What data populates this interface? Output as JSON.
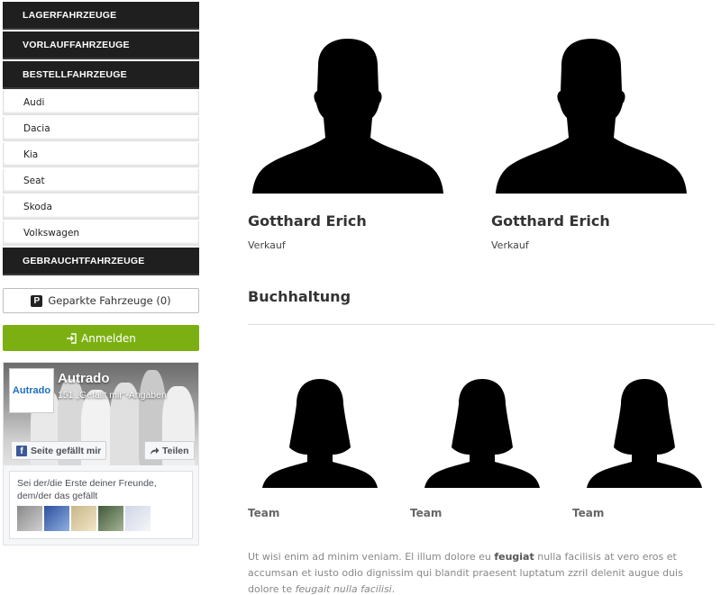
{
  "sidebar": {
    "categories": [
      {
        "label": "LAGERFAHRZEUGE"
      },
      {
        "label": "VORLAUFFAHRZEUGE"
      },
      {
        "label": "BESTELLFAHRZEUGE"
      }
    ],
    "brands": [
      {
        "label": "Audi"
      },
      {
        "label": "Dacia"
      },
      {
        "label": "Kia"
      },
      {
        "label": "Seat"
      },
      {
        "label": "Skoda"
      },
      {
        "label": "Volkswagen"
      }
    ],
    "used": {
      "label": "GEBRAUCHTFAHRZEUGE"
    },
    "parked": {
      "icon": "P",
      "label": "Geparkte Fahrzeuge (0)"
    },
    "login": {
      "label": "Anmelden"
    }
  },
  "facebook": {
    "logo_text": "Autrado",
    "page_name": "Autrado",
    "likes": "151 „Gefällt mir“-Angaben",
    "like_button": "Seite gefällt mir",
    "share_button": "Teilen",
    "friends_text": "Sei der/die Erste deiner Freunde, dem/der das gefällt",
    "brand_color": "#3b5998"
  },
  "staff": [
    {
      "name": "Gotthard Erich",
      "role": "Verkauf"
    },
    {
      "name": "Gotthard Erich",
      "role": "Verkauf"
    }
  ],
  "sections": {
    "accounting_title": "Buchhaltung"
  },
  "team": [
    {
      "label": "Team"
    },
    {
      "label": "Team"
    },
    {
      "label": "Team"
    }
  ],
  "paragraph": {
    "part1": "Ut wisi enim ad minim veniam. El illum dolore eu ",
    "bold": "feugiat",
    "part2": " nulla facilisis at vero eros et accumsan et iusto odio dignissim qui blandit praesent luptatum zzril delenit augue duis dolore te ",
    "italic": "feugait nulla facilisi",
    "part3": "."
  },
  "colors": {
    "nav_dark": "#1f1f1f",
    "login_green": "#7cb012"
  }
}
